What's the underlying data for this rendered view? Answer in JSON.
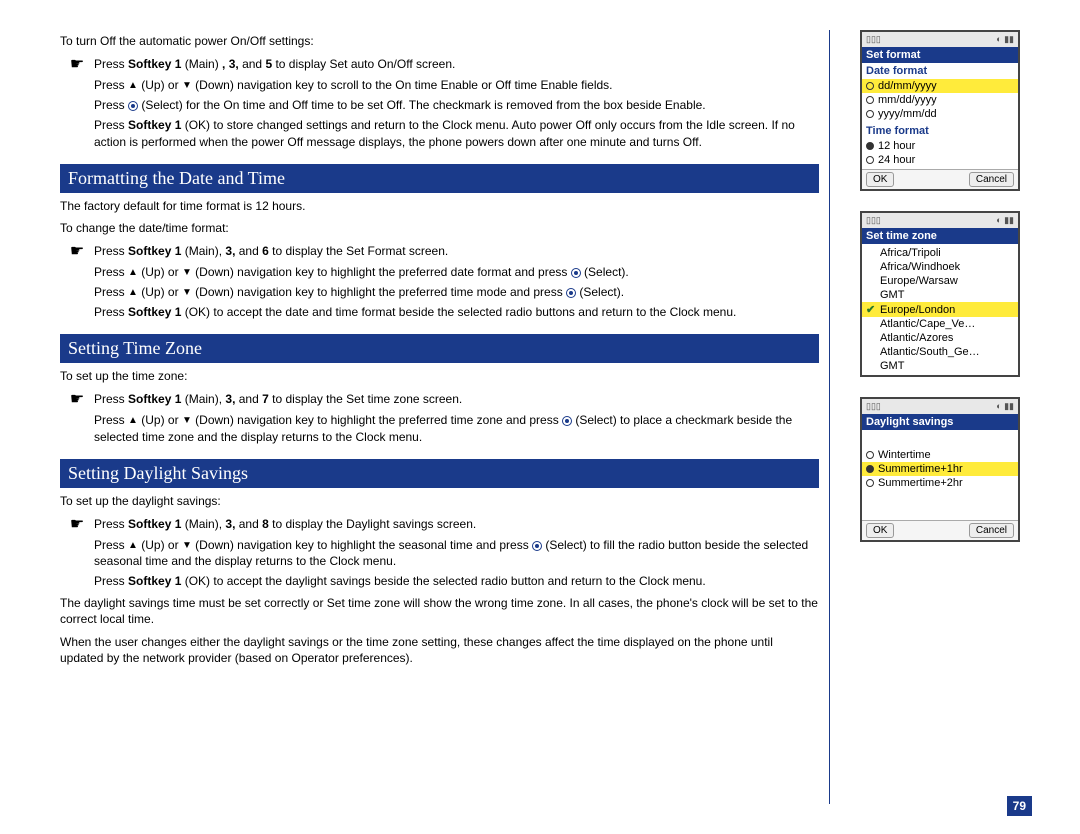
{
  "page_number": "79",
  "icons": {
    "up": "▲",
    "down": "▼"
  },
  "intro1": "To turn Off the automatic power On/Off settings:",
  "steps_a": [
    {
      "ptr": true,
      "html": "Press <b>Softkey 1</b> (Main) <b>, 3,</b> and <b>5</b> to display Set auto On/Off screen."
    },
    {
      "ptr": false,
      "html": "Press {UP} (Up) or {DOWN} (Down) navigation key to scroll to the On time Enable or Off time Enable fields."
    },
    {
      "ptr": false,
      "html": "Press {DOT} (Select) for the On time and Off time to be set Off. The checkmark is removed from the box beside Enable."
    },
    {
      "ptr": false,
      "html": "Press <b>Softkey 1</b> (OK) to store changed settings and return to the Clock menu. Auto power Off only occurs from the Idle screen. If no action is performed when the power Off message displays, the phone powers down after one minute and turns Off."
    }
  ],
  "sec1": {
    "title": "Formatting the Date and Time",
    "intro_a": "The factory default for time format is 12 hours.",
    "intro_b": "To change the date/time format:",
    "steps": [
      {
        "ptr": true,
        "html": "Press <b>Softkey 1</b> (Main), <b>3,</b> and <b>6</b> to display the Set Format screen."
      },
      {
        "ptr": false,
        "html": "Press {UP} (Up) or {DOWN} (Down) navigation key to highlight the preferred date format and press {DOT} (Select)."
      },
      {
        "ptr": false,
        "html": "Press {UP} (Up) or {DOWN} (Down) navigation key to highlight the preferred time mode and press {DOT} (Select)."
      },
      {
        "ptr": false,
        "html": "Press <b>Softkey 1</b> (OK) to accept the date and time format beside the selected radio buttons and return to the Clock menu."
      }
    ]
  },
  "sec2": {
    "title": "Setting Time Zone",
    "intro": "To set up the time zone:",
    "steps": [
      {
        "ptr": true,
        "html": "Press <b>Softkey 1</b> (Main), <b>3,</b> and <b>7</b> to display the Set time zone screen."
      },
      {
        "ptr": false,
        "html": "Press {UP} (Up) or {DOWN} (Down) navigation key to highlight the preferred time zone and press {DOT} (Select) to place a checkmark beside the selected time zone and the display returns to the Clock menu."
      }
    ]
  },
  "sec3": {
    "title": "Setting Daylight Savings",
    "intro": "To set up the daylight savings:",
    "steps": [
      {
        "ptr": true,
        "html": "Press <b>Softkey 1</b> (Main), <b>3,</b> and <b>8</b> to display the Daylight savings screen."
      },
      {
        "ptr": false,
        "html": "Press {UP} (Up) or {DOWN} (Down) navigation key to highlight the seasonal time and press {DOT} (Select) to fill the radio button beside the  selected seasonal time and the display returns to the Clock menu."
      },
      {
        "ptr": false,
        "html": "Press <b>Softkey 1</b> (OK) to accept the daylight savings beside the selected radio button and return to the Clock menu."
      }
    ],
    "after": [
      "The daylight savings time must be set correctly or Set time zone will show the wrong time zone.  In all cases, the phone's clock will be set to the correct local time.",
      "When the user changes either the daylight savings or the time zone setting, these changes affect the time displayed on the phone until updated by the network provider (based on Operator preferences)."
    ]
  },
  "phone1": {
    "title": "Set format",
    "sect_a": "Date format",
    "opts_a": [
      {
        "label": "dd/mm/yyyy",
        "sel": true,
        "on": false
      },
      {
        "label": "mm/dd/yyyy",
        "sel": false,
        "on": false
      },
      {
        "label": "yyyy/mm/dd",
        "sel": false,
        "on": false
      }
    ],
    "sect_b": "Time format",
    "opts_b": [
      {
        "label": "12 hour",
        "sel": false,
        "on": true
      },
      {
        "label": "24 hour",
        "sel": false,
        "on": false
      }
    ],
    "ok": "OK",
    "cancel": "Cancel"
  },
  "phone2": {
    "title": "Set time zone",
    "items": [
      {
        "label": "Africa/Tripoli",
        "sel": false,
        "chk": false
      },
      {
        "label": "Africa/Windhoek",
        "sel": false,
        "chk": false
      },
      {
        "label": "Europe/Warsaw",
        "sel": false,
        "chk": false
      },
      {
        "label": "GMT",
        "sel": false,
        "chk": false
      },
      {
        "label": "Europe/London",
        "sel": true,
        "chk": true
      },
      {
        "label": "Atlantic/Cape_Ve…",
        "sel": false,
        "chk": false
      },
      {
        "label": "Atlantic/Azores",
        "sel": false,
        "chk": false
      },
      {
        "label": "Atlantic/South_Ge…",
        "sel": false,
        "chk": false
      },
      {
        "label": "GMT",
        "sel": false,
        "chk": false
      }
    ]
  },
  "phone3": {
    "title": "Daylight savings",
    "items": [
      {
        "label": "Wintertime",
        "sel": false,
        "on": false
      },
      {
        "label": "Summertime+1hr",
        "sel": true,
        "on": true
      },
      {
        "label": "Summertime+2hr",
        "sel": false,
        "on": false
      }
    ],
    "ok": "OK",
    "cancel": "Cancel"
  }
}
